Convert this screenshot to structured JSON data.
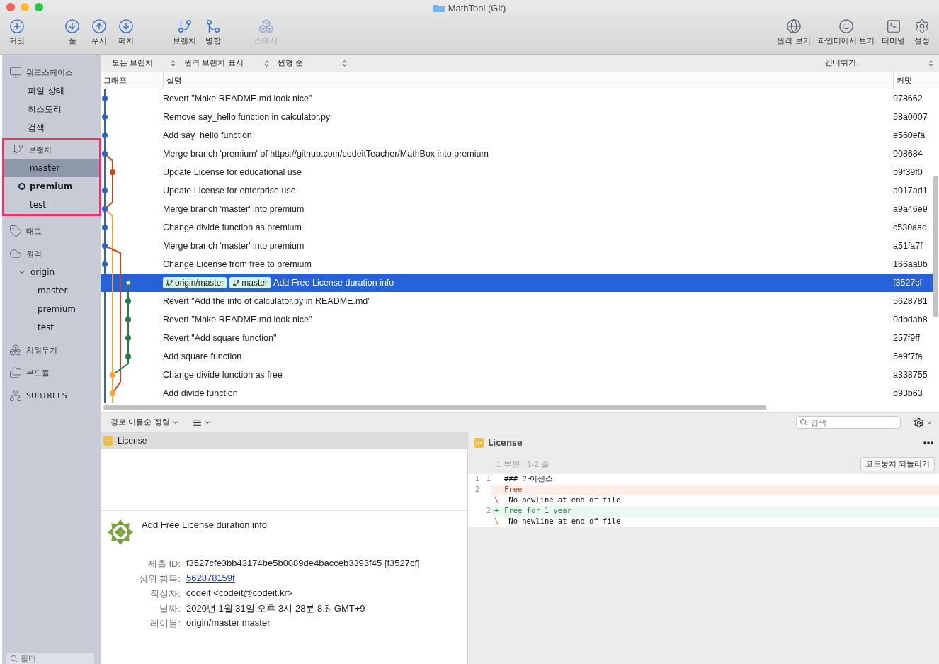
{
  "window": {
    "title": "MathTool (Git)"
  },
  "toolbar": {
    "left": [
      {
        "label": "커밋",
        "disabled": false
      },
      {
        "label": "풀",
        "disabled": false
      },
      {
        "label": "푸시",
        "disabled": false
      },
      {
        "label": "페치",
        "disabled": false
      },
      {
        "label": "브랜치",
        "disabled": false
      },
      {
        "label": "병합",
        "disabled": false
      },
      {
        "label": "스태시",
        "disabled": true
      }
    ],
    "right": [
      {
        "label": "원격 보기"
      },
      {
        "label": "파인더에서 보기"
      },
      {
        "label": "터미널"
      },
      {
        "label": "설정"
      }
    ]
  },
  "sidebar": {
    "sections": [
      {
        "title": "워크스페이스",
        "items": [
          {
            "label": "파일 상태",
            "selected": false,
            "current": false
          },
          {
            "label": "히스토리",
            "selected": false,
            "current": false
          },
          {
            "label": "검색",
            "selected": false,
            "current": false
          }
        ]
      },
      {
        "title": "브랜치",
        "highlighted": true,
        "items": [
          {
            "label": "master",
            "selected": true,
            "current": false
          },
          {
            "label": "premium",
            "selected": false,
            "current": true
          },
          {
            "label": "test",
            "selected": false,
            "current": false
          }
        ]
      },
      {
        "title": "태그"
      },
      {
        "title": "원격",
        "remotes": [
          {
            "name": "origin",
            "expanded": true,
            "children": [
              {
                "label": "master"
              },
              {
                "label": "premium"
              },
              {
                "label": "test"
              }
            ]
          }
        ]
      },
      {
        "title": "치워두기"
      },
      {
        "title": "부모듈"
      },
      {
        "title": "SUBTREES"
      }
    ],
    "filter": {
      "placeholder": "필터"
    }
  },
  "filters": {
    "branches": "모든 브랜치",
    "remote": "원격 브랜치 표시",
    "order": "원형 순",
    "jump": "건너뛰기:"
  },
  "columns": [
    "그래프",
    "설명",
    "커밋"
  ],
  "commits": [
    {
      "message": "Revert \"Make README.md look nice\"",
      "hash": "978662",
      "selected": false
    },
    {
      "message": "Remove say_hello function in calculator.py",
      "hash": "58a0007",
      "selected": false
    },
    {
      "message": "Add say_hello function",
      "hash": "e560efa",
      "selected": false
    },
    {
      "message": "Merge branch 'premium' of https://github.com/codeitTeacher/MathBox into premium",
      "hash": "908684",
      "selected": false
    },
    {
      "message": "Update License for educational use",
      "hash": "b9f39f0",
      "selected": false
    },
    {
      "message": "Update License for enterprise use",
      "hash": "a017ad1",
      "selected": false
    },
    {
      "message": "Merge branch 'master' into premium",
      "hash": "a9a46e9",
      "selected": false
    },
    {
      "message": "Change divide function as premium",
      "hash": "c530aad",
      "selected": false
    },
    {
      "message": "Merge branch 'master' into premium",
      "hash": "a51fa7f",
      "selected": false
    },
    {
      "message": "Change License from free to premium",
      "hash": "166aa8b",
      "selected": false
    },
    {
      "message": "Add Free License duration info",
      "hash": "f3527cf",
      "selected": true,
      "refs": [
        "origin/master",
        "master"
      ]
    },
    {
      "message": "Revert \"Add the info of calculator.py in README.md\"",
      "hash": "5628781",
      "selected": false
    },
    {
      "message": "Revert \"Make README.md look nice\"",
      "hash": "0dbdab8",
      "selected": false
    },
    {
      "message": "Revert \"Add square function\"",
      "hash": "257f9ff",
      "selected": false
    },
    {
      "message": "Add square function",
      "hash": "5e9f7fa",
      "selected": false
    },
    {
      "message": "Change divide function as free",
      "hash": "a338755",
      "selected": false
    },
    {
      "message": "Add divide function",
      "hash": "b93b63",
      "selected": false
    }
  ],
  "bottom": {
    "sort": "경로 이름순 정렬",
    "search": {
      "placeholder": "검색"
    },
    "files": [
      {
        "name": "License",
        "selected": true
      }
    ],
    "details": {
      "message": "Add Free License duration info",
      "fields": [
        {
          "label": "제출 ID:",
          "value": "f3527cfe3bb43174be5b0089de4bacceb3393f45 [f3527cf]",
          "kind": "text"
        },
        {
          "label": "상위 항목:",
          "value": "562878159f",
          "kind": "link"
        },
        {
          "label": "작성자:",
          "value": "codeit <codeit@codeit.kr>",
          "kind": "text"
        },
        {
          "label": "날짜:",
          "value": "2020년 1월 31일 오후 3시 28분 8초 GMT+9",
          "kind": "text"
        },
        {
          "label": "레이블:",
          "value": "origin/master master",
          "kind": "text"
        }
      ]
    }
  },
  "diff": {
    "file": "License",
    "hunk": "1 부분 : 1-2 줄",
    "revert": "코드뭉치 되돌리기",
    "lines": [
      {
        "old": "1",
        "new": "1",
        "kind": "context",
        "text": "### 라이센스"
      },
      {
        "old": "2",
        "kind": "removed",
        "sign": "-",
        "text": "Free"
      },
      {
        "kind": "note",
        "sign": "\\",
        "text": "No newline at end of file"
      },
      {
        "new": "2",
        "kind": "added",
        "sign": "+",
        "text": "Free for 1 year"
      },
      {
        "kind": "note",
        "sign": "\\",
        "text": "No newline at end of file"
      }
    ]
  }
}
